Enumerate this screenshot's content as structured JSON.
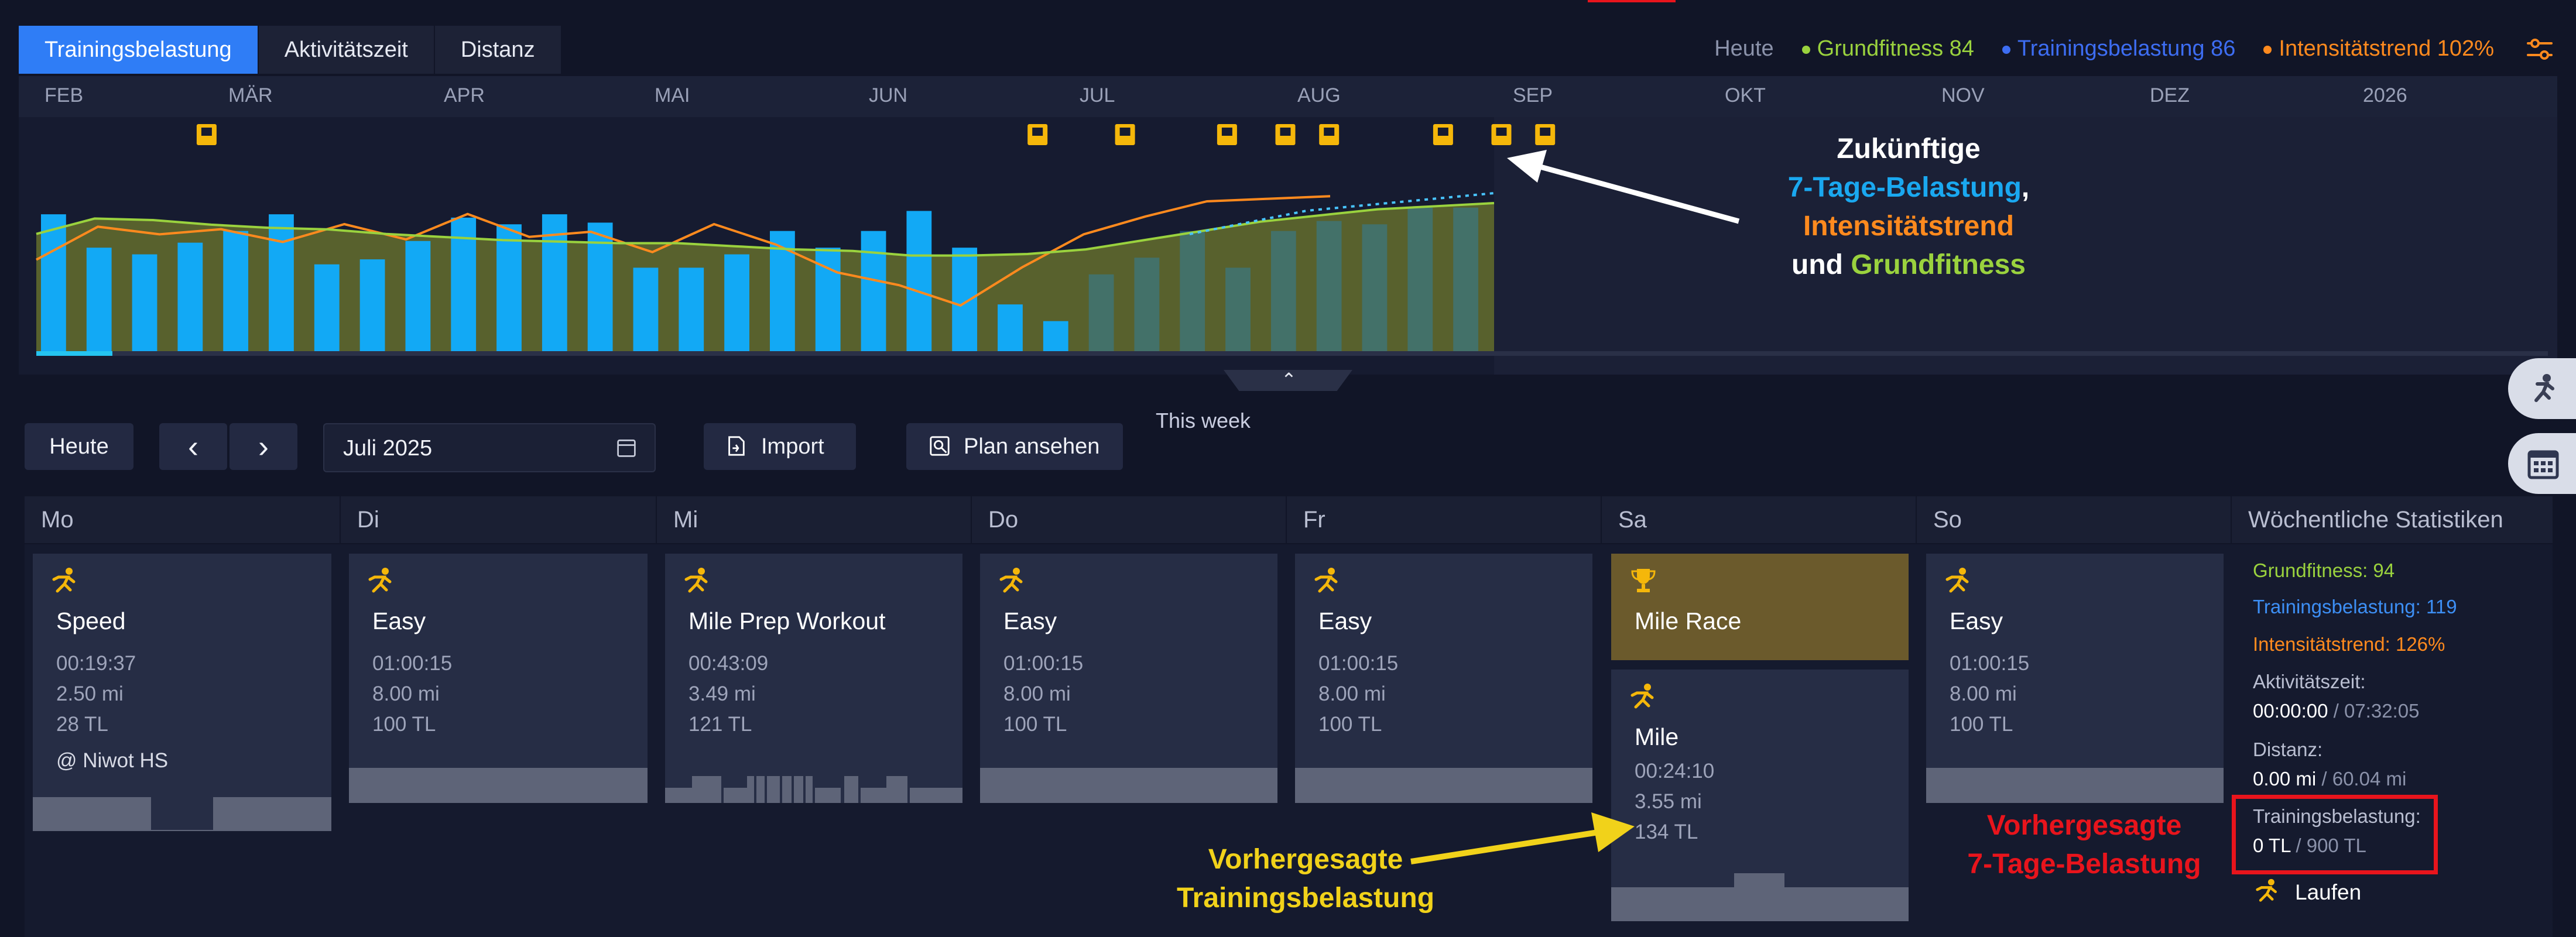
{
  "tabs": [
    "Trainingsbelastung",
    "Aktivitätszeit",
    "Distanz"
  ],
  "legend": {
    "today": "Heute",
    "fitness": "Grundfitness 84",
    "load": "Trainingsbelastung 86",
    "trend": "Intensitätstrend 102%"
  },
  "colors": {
    "fitness": "#9ad23e",
    "load": "#3d6df2",
    "trend": "#ff8a1e",
    "bars": "#12a9f5",
    "accent": "#2f7df6",
    "highlight": "#e8141c"
  },
  "months": [
    "FEB",
    "MÄR",
    "APR",
    "MAI",
    "JUN",
    "JUL",
    "AUG",
    "SEP",
    "OKT",
    "NOV",
    "DEZ",
    "2026"
  ],
  "chart": {
    "this_week": "This week",
    "annotation_l1": "Zukünftige",
    "annotation_l2a": "7-Tage-Belastung",
    "annotation_l2b": ",",
    "annotation_l3": "Intensitätstrend",
    "annotation_l4a": "und",
    "annotation_l4b": "Grundfitness"
  },
  "chart_data": {
    "type": "bar",
    "bars_relative": [
      0.82,
      0.62,
      0.58,
      0.65,
      0.72,
      0.82,
      0.52,
      0.55,
      0.66,
      0.8,
      0.76,
      0.82,
      0.77,
      0.5,
      0.5,
      0.58,
      0.72,
      0.62,
      0.72,
      0.84,
      0.62,
      0.28,
      0.18,
      0.46,
      0.56,
      0.72,
      0.5,
      0.72,
      0.78,
      0.76,
      0.86,
      0.86
    ],
    "fitness_relative": [
      0.76,
      0.86,
      0.85,
      0.82,
      0.8,
      0.79,
      0.76,
      0.74,
      0.72,
      0.71,
      0.7,
      0.7,
      0.68,
      0.66,
      0.65,
      0.62,
      0.62,
      0.63,
      0.66,
      0.72,
      0.78,
      0.84,
      0.88,
      0.92,
      0.94,
      0.96
    ],
    "trend_relative": [
      0.72,
      0.98,
      0.92,
      0.96,
      0.86,
      1.0,
      0.88,
      1.08,
      0.9,
      0.94,
      0.78,
      1.0,
      0.84,
      0.62,
      0.52,
      0.36,
      0.66,
      0.92,
      1.06,
      1.18,
      1.2,
      1.22
    ],
    "events_relative": [
      0.11,
      0.68,
      0.74,
      0.81,
      0.85,
      0.88,
      0.91,
      0.95,
      0.98
    ]
  },
  "toolbar": {
    "today": "Heute",
    "prev": "‹",
    "next": "›",
    "month": "Juli 2025",
    "import": "Import",
    "plan": "Plan ansehen"
  },
  "days": [
    "Mo",
    "Di",
    "Mi",
    "Do",
    "Fr",
    "Sa",
    "So"
  ],
  "stats_header": "Wöchentliche Statistiken",
  "workouts": {
    "mo": {
      "title": "Speed",
      "time": "00:19:37",
      "dist": "2.50 mi",
      "tl": "28 TL",
      "loc": "@ Niwot HS"
    },
    "di": {
      "title": "Easy",
      "time": "01:00:15",
      "dist": "8.00 mi",
      "tl": "100 TL"
    },
    "mi": {
      "title": "Mile Prep Workout",
      "time": "00:43:09",
      "dist": "3.49 mi",
      "tl": "121 TL"
    },
    "do": {
      "title": "Easy",
      "time": "01:00:15",
      "dist": "8.00 mi",
      "tl": "100 TL"
    },
    "fr": {
      "title": "Easy",
      "time": "01:00:15",
      "dist": "8.00 mi",
      "tl": "100 TL"
    },
    "sa_race": {
      "title": "Mile Race"
    },
    "sa": {
      "title": "Mile",
      "time": "00:24:10",
      "dist": "3.55 mi",
      "tl": "134 TL"
    },
    "so": {
      "title": "Easy",
      "time": "01:00:15",
      "dist": "8.00 mi",
      "tl": "100 TL"
    }
  },
  "stats": {
    "fitness": "Grundfitness: 94",
    "load": "Trainingsbelastung: 119",
    "trend": "Intensitätstrend: 126%",
    "time_label": "Aktivitätszeit:",
    "time_value": "00:00:00",
    "time_target": " / 07:32:05",
    "dist_label": "Distanz:",
    "dist_value": "0.00 mi",
    "dist_target": " / 60.04 mi",
    "tl_label": "Trainingsbelastung:",
    "tl_value": "0 TL",
    "tl_target": " / 900 TL",
    "sport": "Laufen"
  },
  "annotations": {
    "red_l1": "Vorhergesagte",
    "red_l2": "7-Tage-Belastung",
    "yellow_l1": "Vorhergesagte",
    "yellow_l2": "Trainingsbelastung"
  }
}
